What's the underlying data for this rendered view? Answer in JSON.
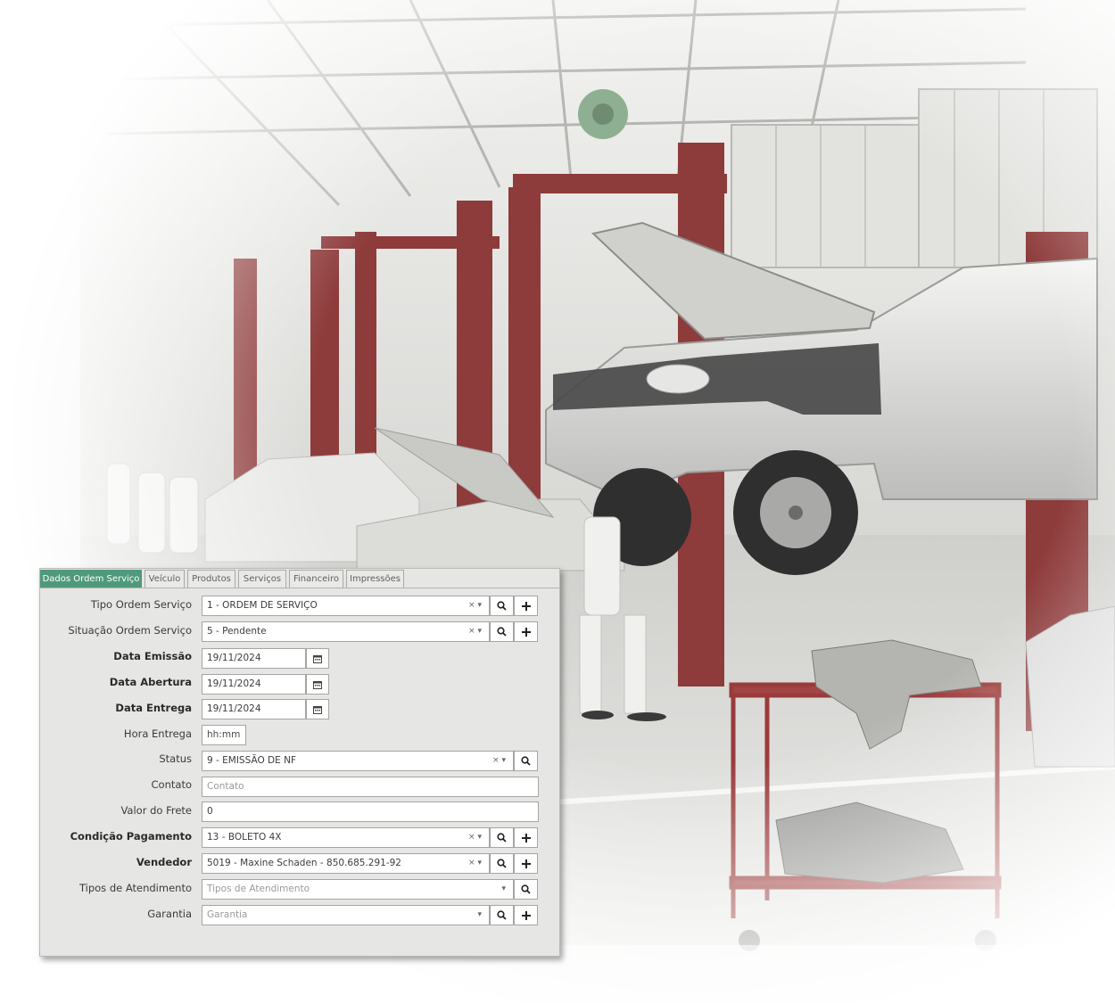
{
  "tabs": [
    {
      "label": "Dados Ordem Serviço",
      "active": true
    },
    {
      "label": "Veículo",
      "active": false
    },
    {
      "label": "Produtos",
      "active": false
    },
    {
      "label": "Serviços",
      "active": false
    },
    {
      "label": "Financeiro",
      "active": false
    },
    {
      "label": "Impressões",
      "active": false
    }
  ],
  "form": {
    "tipo_ordem": {
      "label": "Tipo Ordem Serviço",
      "value": "1 - ORDEM DE SERVIÇO"
    },
    "situacao_ordem": {
      "label": "Situação Ordem Serviço",
      "value": "5 - Pendente"
    },
    "data_emissao": {
      "label": "Data Emissão",
      "value": "19/11/2024"
    },
    "data_abertura": {
      "label": "Data Abertura",
      "value": "19/11/2024"
    },
    "data_entrega": {
      "label": "Data Entrega",
      "value": "19/11/2024"
    },
    "hora_entrega": {
      "label": "Hora Entrega",
      "placeholder": "hh:mm"
    },
    "status": {
      "label": "Status",
      "value": "9 - EMISSÃO DE NF"
    },
    "contato": {
      "label": "Contato",
      "placeholder": "Contato"
    },
    "valor_frete": {
      "label": "Valor do Frete",
      "value": "0"
    },
    "condicao_pagamento": {
      "label": "Condição Pagamento",
      "value": "13 - BOLETO 4X"
    },
    "vendedor": {
      "label": "Vendedor",
      "value": "5019 - Maxine Schaden - 850.685.291-92"
    },
    "tipos_atendimento": {
      "label": "Tipos de Atendimento",
      "placeholder": "Tipos de Atendimento"
    },
    "garantia": {
      "label": "Garantia",
      "placeholder": "Garantia"
    }
  },
  "glyphs": {
    "clear": "×",
    "caret": "▾"
  },
  "colors": {
    "active_tab": "#4f9a7c",
    "panel_bg": "#e6e6e4",
    "lift_red": "#8e3b3b"
  },
  "icons": [
    "search-icon",
    "plus-icon",
    "calendar-icon",
    "chevron-down-icon",
    "clear-icon"
  ]
}
